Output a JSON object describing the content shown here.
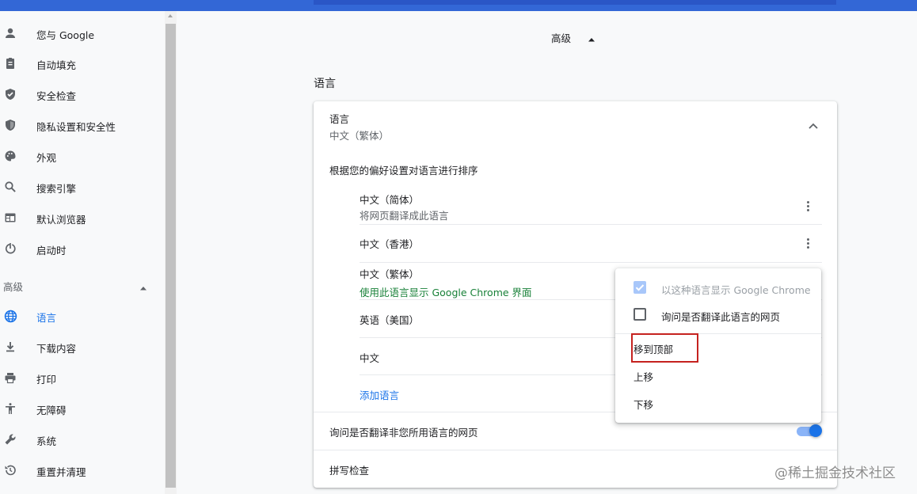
{
  "sidebar": {
    "items": [
      {
        "label": "您与 Google",
        "icon": "person-icon"
      },
      {
        "label": "自动填充",
        "icon": "clipboard-icon"
      },
      {
        "label": "安全检查",
        "icon": "shield-check-icon"
      },
      {
        "label": "隐私设置和安全性",
        "icon": "shield-icon"
      },
      {
        "label": "外观",
        "icon": "palette-icon"
      },
      {
        "label": "搜索引擎",
        "icon": "search-icon"
      },
      {
        "label": "默认浏览器",
        "icon": "browser-icon"
      },
      {
        "label": "启动时",
        "icon": "power-icon"
      }
    ],
    "advanced_label": "高级",
    "advanced_items": [
      {
        "label": "语言",
        "icon": "globe-icon",
        "active": true
      },
      {
        "label": "下载内容",
        "icon": "download-icon"
      },
      {
        "label": "打印",
        "icon": "printer-icon"
      },
      {
        "label": "无障碍",
        "icon": "accessibility-icon"
      },
      {
        "label": "系统",
        "icon": "wrench-icon"
      },
      {
        "label": "重置并清理",
        "icon": "restore-icon"
      }
    ]
  },
  "main": {
    "advanced_header": "高级",
    "section_title": "语言",
    "languages_card": {
      "title": "语言",
      "current": "中文（繁体）",
      "order_label": "根据您的偏好设置对语言进行排序",
      "languages": [
        {
          "name": "中文（简体）",
          "note": "将网页翻译成此语言"
        },
        {
          "name": "中文（香港）",
          "note": ""
        },
        {
          "name": "中文（繁体）",
          "note": "使用此语言显示 Google Chrome 界面"
        },
        {
          "name": "英语（美国）",
          "note": ""
        },
        {
          "name": "中文",
          "note": ""
        }
      ],
      "add_language": "添加语言",
      "offer_translate": "询问是否翻译非您所用语言的网页",
      "offer_translate_on": true,
      "spellcheck": "拼写检查"
    }
  },
  "menu": {
    "display_chrome": "以这种语言显示 Google Chrome",
    "ask_translate": "询问是否翻译此语言的网页",
    "move_top": "移到顶部",
    "move_up": "上移",
    "move_down": "下移"
  },
  "watermark": "@稀土掘金技术社区",
  "colors": {
    "accent": "#1a73e8",
    "topbar": "#3367d6",
    "green_note": "#188038",
    "highlight": "#c5221f"
  }
}
